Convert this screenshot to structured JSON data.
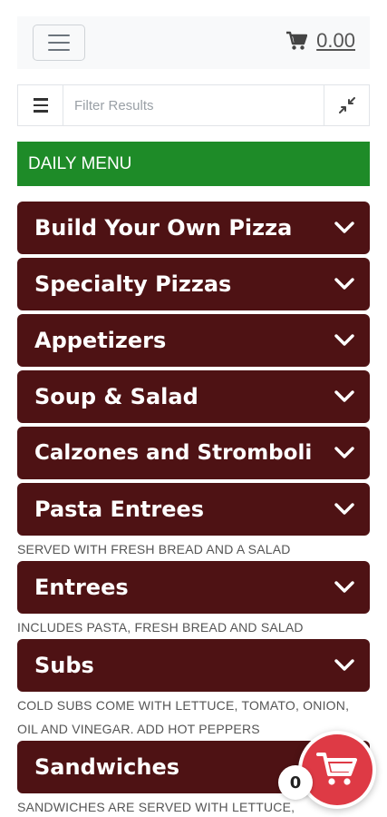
{
  "header": {
    "cart_total": "0.00"
  },
  "filter": {
    "placeholder": "Filter Results"
  },
  "daily_menu_label": "DAILY MENU",
  "categories": [
    {
      "label": "Build Your Own Pizza"
    },
    {
      "label": "Specialty Pizzas"
    },
    {
      "label": "Appetizers"
    },
    {
      "label": "Soup & Salad"
    },
    {
      "label": "Calzones and Stromboli"
    },
    {
      "label": "Pasta Entrees",
      "note": "SERVED WITH FRESH BREAD AND A SALAD"
    },
    {
      "label": "Entrees",
      "note": "INCLUDES PASTA, FRESH BREAD AND SALAD"
    },
    {
      "label": "Subs",
      "note": "COLD SUBS COME WITH LETTUCE, TOMATO, ONION, OIL AND VINEGAR. ADD HOT PEPPERS"
    },
    {
      "label": "Sandwiches",
      "note": "SANDWICHES ARE SERVED WITH LETTUCE,"
    }
  ],
  "floating_cart": {
    "count": "0"
  },
  "colors": {
    "category_bg": "#4e1214",
    "daily_menu_bg": "#1e8b28",
    "fab_bg": "#de3a45"
  },
  "icons": [
    "hamburger-icon",
    "cart-icon",
    "list-icon",
    "collapse-icon",
    "chevron-down-icon"
  ]
}
